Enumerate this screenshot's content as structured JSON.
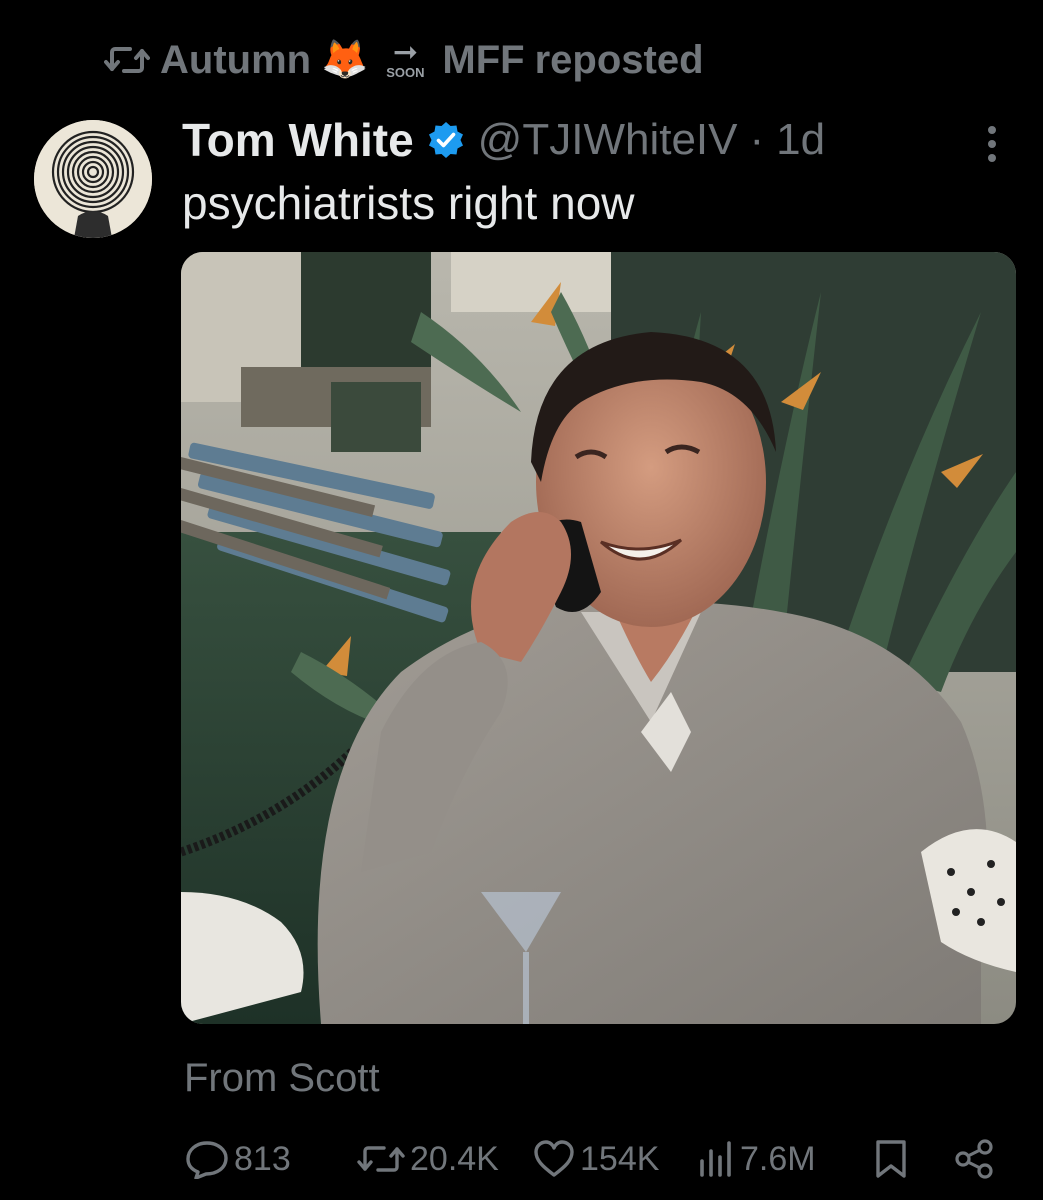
{
  "repost": {
    "user": "Autumn",
    "fox_emoji": "🦊",
    "arrow_glyph": "➞",
    "soon_label": "SOON",
    "account": "MFF",
    "action_text": "reposted"
  },
  "tweet": {
    "author_name": "Tom White",
    "handle": "@TJIWhiteIV",
    "separator": "·",
    "time": "1d",
    "text": "psychiatrists right now",
    "source": "From Scott"
  },
  "stats": {
    "replies": "813",
    "reposts": "20.4K",
    "likes": "154K",
    "views": "7.6M"
  },
  "colors": {
    "background": "#000000",
    "primary_text": "#e7e9ea",
    "secondary_text": "#71767b",
    "verified_blue": "#1d9bf0"
  },
  "icons": {
    "repost": "repost-icon",
    "verified": "verified-badge-icon",
    "more": "more-options-icon",
    "mute": "muted-speaker-icon",
    "reply": "reply-bubble-icon",
    "like": "heart-icon",
    "views": "views-bar-chart-icon",
    "bookmark": "bookmark-icon",
    "share": "share-icon"
  }
}
